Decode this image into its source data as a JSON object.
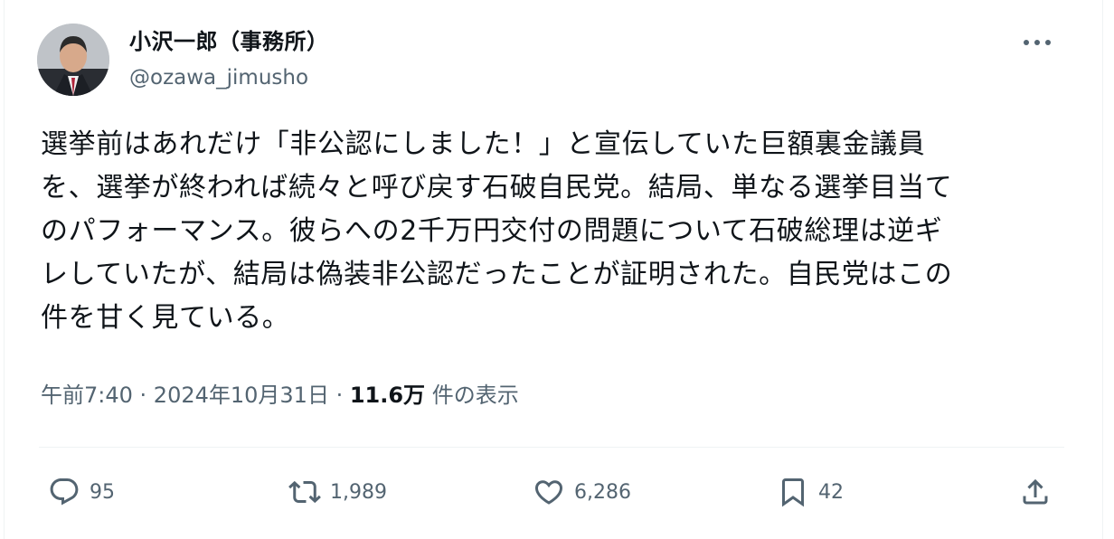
{
  "author": {
    "display_name": "小沢一郎（事務所）",
    "handle": "@ozawa_jimusho",
    "avatar_icon": "avatar-photo"
  },
  "more_icon": "more-horizontal-icon",
  "tweet": {
    "text": "選挙前はあれだけ「非公認にしました！」と宣伝していた巨額裏金議員\nを、選挙が終われば続々と呼び戻す石破自民党。結局、単なる選挙目当て\nのパフォーマンス。彼らへの2千万円交付の問題について石破総理は逆ギ\nレしていたが、結局は偽装非公認だったことが証明された。自民党はこの\n件を甘く見ている。"
  },
  "meta": {
    "time": "午前7:40",
    "sep1": " · ",
    "date": "2024年10月31日",
    "sep2": " · ",
    "views": "11.6万",
    "views_label": " 件の表示"
  },
  "actions": {
    "reply": {
      "icon": "reply-icon",
      "count": "95"
    },
    "retweet": {
      "icon": "retweet-icon",
      "count": "1,989"
    },
    "like": {
      "icon": "heart-icon",
      "count": "6,286"
    },
    "bookmark": {
      "icon": "bookmark-icon",
      "count": "42"
    },
    "share": {
      "icon": "share-icon"
    }
  },
  "colors": {
    "text": "#0f1419",
    "secondary": "#536471",
    "divider": "#eff3f4"
  }
}
